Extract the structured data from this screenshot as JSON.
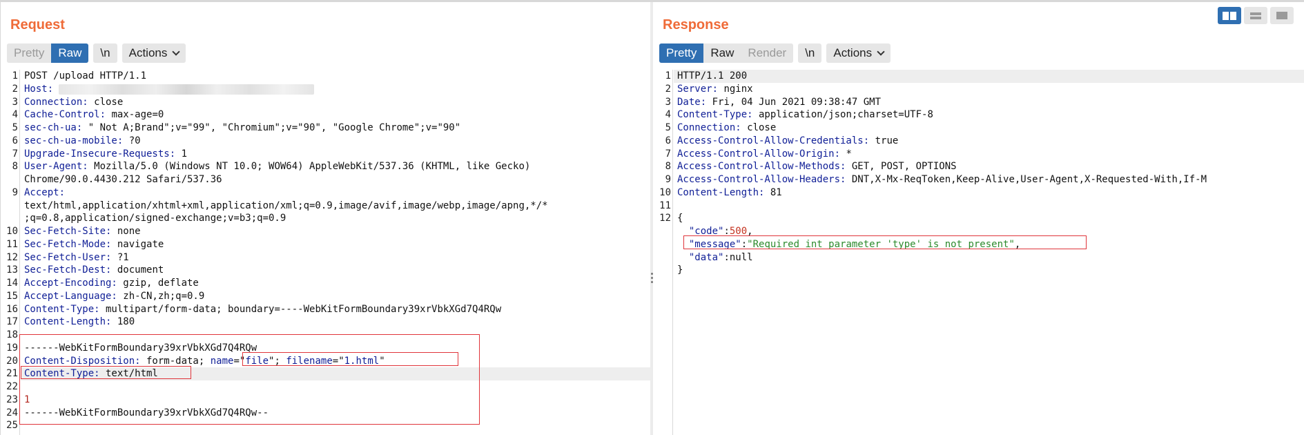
{
  "request": {
    "title": "Request",
    "tabs": [
      {
        "label": "Pretty",
        "state": "disabled"
      },
      {
        "label": "Raw",
        "state": "active"
      }
    ],
    "newline_label": "\\n",
    "actions_label": "Actions",
    "lines": [
      {
        "n": "1",
        "k": "",
        "v": "POST /upload HTTP/1.1"
      },
      {
        "n": "2",
        "k": "Host:",
        "v": "",
        "redacted": true
      },
      {
        "n": "3",
        "k": "Connection:",
        "v": " close"
      },
      {
        "n": "4",
        "k": "Cache-Control:",
        "v": " max-age=0"
      },
      {
        "n": "5",
        "k": "sec-ch-ua:",
        "v": " \" Not A;Brand\";v=\"99\", \"Chromium\";v=\"90\", \"Google Chrome\";v=\"90\""
      },
      {
        "n": "6",
        "k": "sec-ch-ua-mobile:",
        "v": " ?0"
      },
      {
        "n": "7",
        "k": "Upgrade-Insecure-Requests:",
        "v": " 1"
      },
      {
        "n": "8",
        "k": "User-Agent:",
        "v": " Mozilla/5.0 (Windows NT 10.0; WOW64) AppleWebKit/537.36 (KHTML, like Gecko)"
      },
      {
        "n": "",
        "k": "",
        "v": "Chrome/90.0.4430.212 Safari/537.36"
      },
      {
        "n": "9",
        "k": "Accept:",
        "v": ""
      },
      {
        "n": "",
        "k": "",
        "v": "text/html,application/xhtml+xml,application/xml;q=0.9,image/avif,image/webp,image/apng,*/*"
      },
      {
        "n": "",
        "k": "",
        "v": ";q=0.8,application/signed-exchange;v=b3;q=0.9"
      },
      {
        "n": "10",
        "k": "Sec-Fetch-Site:",
        "v": " none"
      },
      {
        "n": "11",
        "k": "Sec-Fetch-Mode:",
        "v": " navigate"
      },
      {
        "n": "12",
        "k": "Sec-Fetch-User:",
        "v": " ?1"
      },
      {
        "n": "13",
        "k": "Sec-Fetch-Dest:",
        "v": " document"
      },
      {
        "n": "14",
        "k": "Accept-Encoding:",
        "v": " gzip, deflate"
      },
      {
        "n": "15",
        "k": "Accept-Language:",
        "v": " zh-CN,zh;q=0.9"
      },
      {
        "n": "16",
        "k": "Content-Type:",
        "v": " multipart/form-data; boundary=----WebKitFormBoundary39xrVbkXGd7Q4RQw"
      },
      {
        "n": "17",
        "k": "Content-Length:",
        "v": " 180"
      },
      {
        "n": "18",
        "k": "",
        "v": ""
      },
      {
        "n": "19",
        "k": "",
        "v": "------WebKitFormBoundary39xrVbkXGd7Q4RQw"
      },
      {
        "n": "20",
        "k": "Content-Disposition:",
        "v": " form-data; ",
        "extra": [
          {
            "c": "k",
            "t": "name"
          },
          {
            "c": "",
            "t": "=\""
          },
          {
            "c": "k",
            "t": "file"
          },
          {
            "c": "",
            "t": "\"; "
          },
          {
            "c": "k",
            "t": "filename"
          },
          {
            "c": "",
            "t": "=\""
          },
          {
            "c": "k",
            "t": "1.html"
          },
          {
            "c": "",
            "t": "\""
          }
        ]
      },
      {
        "n": "21",
        "k": "Content-Type:",
        "v": " text/html",
        "highlight": true
      },
      {
        "n": "22",
        "k": "",
        "v": ""
      },
      {
        "n": "23",
        "k": "",
        "v": "1",
        "red": true
      },
      {
        "n": "24",
        "k": "",
        "v": "------WebKitFormBoundary39xrVbkXGd7Q4RQw--"
      },
      {
        "n": "25",
        "k": "",
        "v": ""
      }
    ]
  },
  "response": {
    "title": "Response",
    "tabs": [
      {
        "label": "Pretty",
        "state": "active"
      },
      {
        "label": "Raw",
        "state": "normal"
      },
      {
        "label": "Render",
        "state": "disabled"
      }
    ],
    "newline_label": "\\n",
    "actions_label": "Actions",
    "lines": [
      {
        "n": "1",
        "k": "",
        "v": "HTTP/1.1 200",
        "highlight": true
      },
      {
        "n": "2",
        "k": "Server:",
        "v": " nginx"
      },
      {
        "n": "3",
        "k": "Date:",
        "v": " Fri, 04 Jun 2021 09:38:47 GMT"
      },
      {
        "n": "4",
        "k": "Content-Type:",
        "v": " application/json;charset=UTF-8"
      },
      {
        "n": "5",
        "k": "Connection:",
        "v": " close"
      },
      {
        "n": "6",
        "k": "Access-Control-Allow-Credentials:",
        "v": " true"
      },
      {
        "n": "7",
        "k": "Access-Control-Allow-Origin:",
        "v": " *"
      },
      {
        "n": "8",
        "k": "Access-Control-Allow-Methods:",
        "v": " GET, POST, OPTIONS"
      },
      {
        "n": "9",
        "k": "Access-Control-Allow-Headers:",
        "v": " DNT,X-Mx-ReqToken,Keep-Alive,User-Agent,X-Requested-With,If-M"
      },
      {
        "n": "10",
        "k": "Content-Length:",
        "v": " 81"
      },
      {
        "n": "11",
        "k": "",
        "v": ""
      },
      {
        "n": "12",
        "k": "",
        "v": "{"
      },
      {
        "n": "",
        "k": "",
        "v": "",
        "json": [
          {
            "c": "",
            "t": "  "
          },
          {
            "c": "k",
            "t": "\"code\""
          },
          {
            "c": "",
            "t": ":"
          },
          {
            "c": "n",
            "t": "500"
          },
          {
            "c": "",
            "t": ","
          }
        ]
      },
      {
        "n": "",
        "k": "",
        "v": "",
        "json": [
          {
            "c": "",
            "t": "  "
          },
          {
            "c": "k",
            "t": "\"message\""
          },
          {
            "c": "",
            "t": ":"
          },
          {
            "c": "s",
            "t": "\"Required int parameter 'type' is not present\""
          },
          {
            "c": "",
            "t": ","
          }
        ]
      },
      {
        "n": "",
        "k": "",
        "v": "",
        "json": [
          {
            "c": "",
            "t": "  "
          },
          {
            "c": "k",
            "t": "\"data\""
          },
          {
            "c": "",
            "t": ":null"
          }
        ]
      },
      {
        "n": "",
        "k": "",
        "v": "}"
      }
    ]
  },
  "layout_toggle": [
    {
      "name": "side-by-side",
      "state": "active"
    },
    {
      "name": "stacked",
      "state": "inactive"
    },
    {
      "name": "tabbed",
      "state": "inactive"
    }
  ],
  "colors": {
    "accent": "#ef6b38",
    "active": "#2f6fb2",
    "header_key": "#0f1e96",
    "json_string": "#2c8a2c",
    "annotation_box": "#e0343a"
  }
}
